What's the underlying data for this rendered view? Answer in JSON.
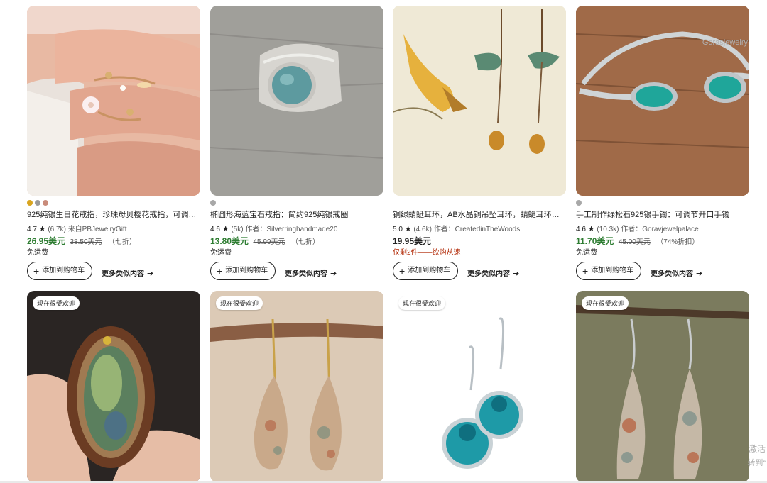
{
  "row1": [
    {
      "swatches": [
        "#d9a520",
        "#9a9a9a",
        "#c98b7a"
      ],
      "title": "925纯银生日花戒指，珍珠母贝樱花戒指，可调节...",
      "rating": "4.7",
      "reviews": "(6.7k)",
      "seller": "来自PBJewelryGift",
      "price": "26.95美元",
      "orig_price": "38.50美元",
      "discount": "（七折）",
      "shipping": "免运费",
      "add_label": "添加到购物车",
      "more_label": "更多类似内容"
    },
    {
      "swatches": [
        "#a8a8a8"
      ],
      "title": "椭圆形海蓝宝石戒指：简约925纯银戒圈",
      "rating": "4.6",
      "reviews": "(5k)",
      "seller": "作者：Silverringhandmade20",
      "price": "13.80美元",
      "orig_price": "45.99美元",
      "discount": "（七折）",
      "shipping": "免运费",
      "add_label": "添加到购物车",
      "more_label": "更多类似内容"
    },
    {
      "swatches": [],
      "title": "铜绿蜻蜓耳环，AB水晶铜吊坠耳环，蜻蜓耳环，水...",
      "rating": "5.0",
      "reviews": "(4.6k)",
      "seller": "作者：CreatedinTheWoods",
      "price": "19.95美元",
      "orig_price": "",
      "discount": "",
      "shipping": "仅剩2件——欲购从速",
      "add_label": "添加到购物车",
      "more_label": "更多类似内容"
    },
    {
      "swatches": [
        "#a8a8a8"
      ],
      "title": "手工制作绿松石925银手镯：可调节开口手镯",
      "rating": "4.6",
      "reviews": "(10.3k)",
      "seller": "作者：Goravjewelpalace",
      "price": "11.70美元",
      "orig_price": "45.00美元",
      "discount": "（74%折扣）",
      "shipping": "免运费",
      "add_label": "添加到购物车",
      "more_label": "更多类似内容"
    }
  ],
  "row2": [
    {
      "badge": "现在很受欢迎"
    },
    {
      "badge": "现在很受欢迎"
    },
    {
      "badge": "现在很受欢迎"
    },
    {
      "badge": "现在很受欢迎"
    }
  ],
  "image_watermark": "Gorasjewelry",
  "overlay": {
    "line1": "激活",
    "line2": "转到“"
  },
  "colors": {
    "sale_price": "#2e7d32",
    "urgency": "#b12704",
    "accent": "#222222"
  },
  "icons": {
    "star": "star-icon",
    "plus": "plus-icon",
    "arrow": "arrow-right-icon"
  }
}
